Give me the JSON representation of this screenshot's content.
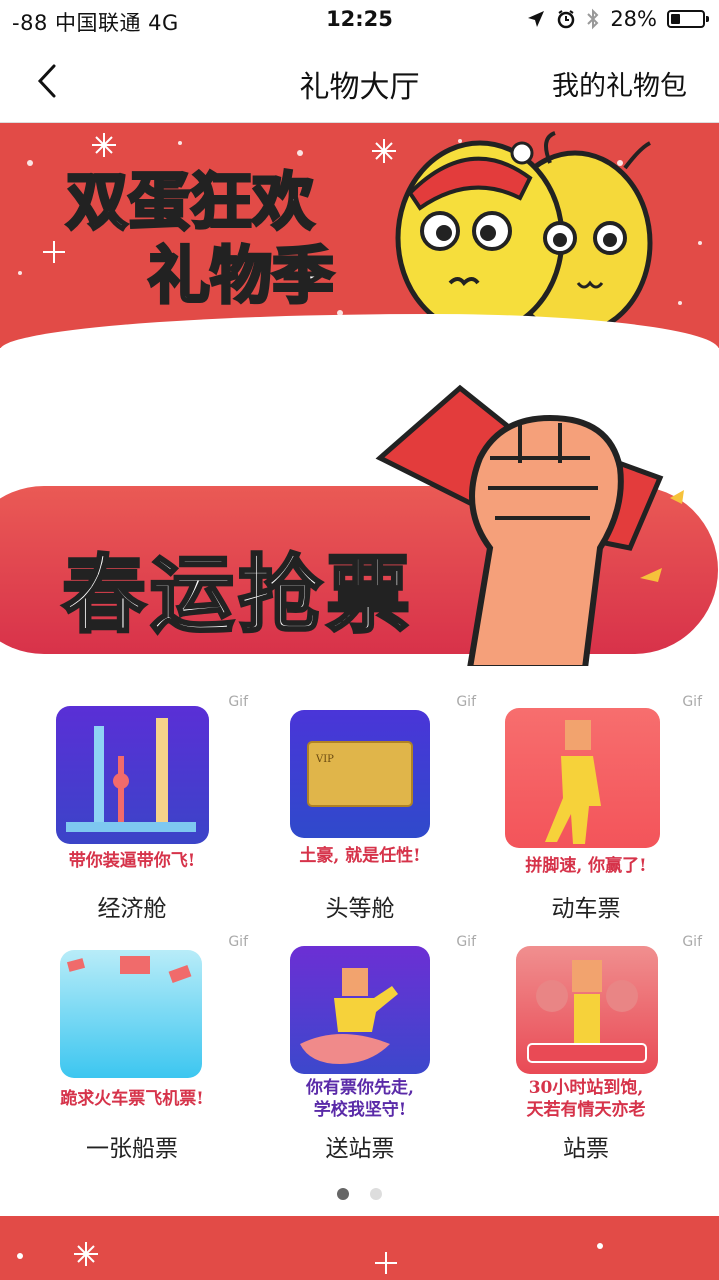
{
  "status": {
    "carrier": "-88 中国联通   4G",
    "time": "12:25",
    "battery": "28%",
    "battery_level": 0.28,
    "icons": [
      "location-arrow-icon",
      "alarm-icon",
      "bluetooth-icon",
      "battery-icon"
    ]
  },
  "nav": {
    "title": "礼物大厅",
    "right_label": "我的礼物包",
    "back_icon": "chevron-left-icon"
  },
  "banner": {
    "line1": "双蛋狂欢",
    "line2": "礼物季",
    "color": "#e24b47"
  },
  "hero": {
    "title": "春运抢票",
    "color": "#dc3a4c"
  },
  "gif_tag": "Gif",
  "gifts": [
    {
      "caption": "带你装逼带你飞!",
      "label": "经济舱",
      "caption_color": "#d6334a"
    },
    {
      "caption": "土豪, 就是任性!",
      "label": "头等舱",
      "caption_color": "#d6334a"
    },
    {
      "caption": "拼脚速, 你赢了!",
      "label": "动车票",
      "caption_color": "#d6334a"
    },
    {
      "caption": "跪求火车票飞机票!",
      "label": "一张船票",
      "caption_color": "#d6334a"
    },
    {
      "caption": "你有票你先走,\n学校我坚守!",
      "label": "送站票",
      "caption_color": "#5a2aa8"
    },
    {
      "caption": "30小时站到饱,\n天若有情天亦老",
      "label": "站票",
      "caption_color": "#d6334a"
    }
  ],
  "pagination": {
    "count": 2,
    "active": 0
  }
}
